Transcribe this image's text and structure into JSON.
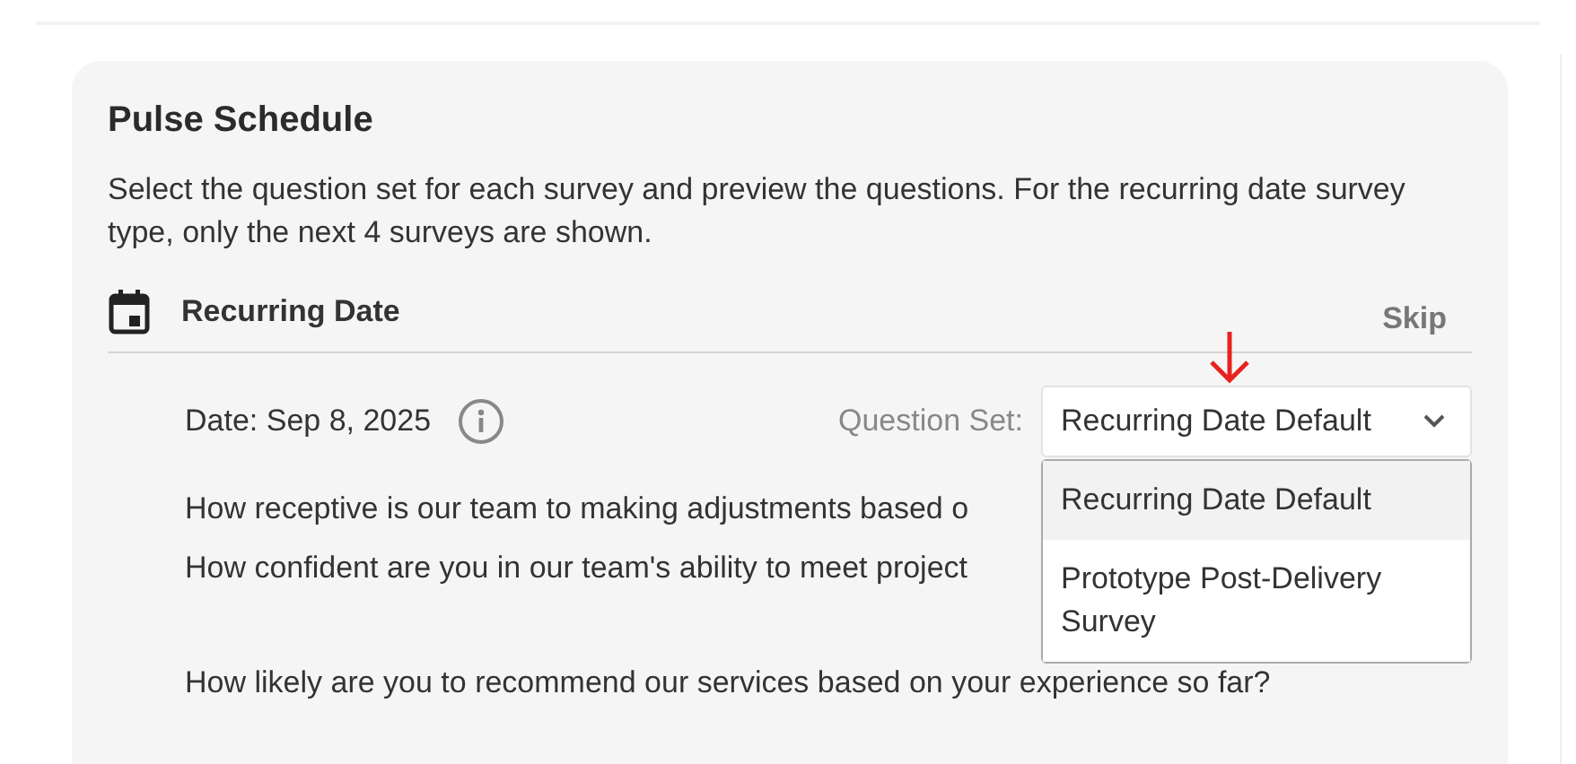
{
  "card": {
    "title": "Pulse Schedule",
    "description": "Select the question set for each survey and preview the questions. For the recurring date survey type, only the next 4 surveys are shown."
  },
  "survey": {
    "type": "Recurring Date",
    "skip": "Skip",
    "date": "Date: Sep 8, 2025",
    "question_set_label": "Question Set:",
    "question_set_value": "Recurring Date Default",
    "menu_open": true,
    "options": [
      {
        "label": "Recurring Date Default",
        "selected": true
      },
      {
        "label": "Prototype Post-Delivery Survey",
        "selected": false
      }
    ],
    "questions": [
      "How receptive is our team to making adjustments based o",
      "How confident are you in our team's ability to meet project",
      "How likely are you to recommend our services based on your experience so far?"
    ]
  }
}
